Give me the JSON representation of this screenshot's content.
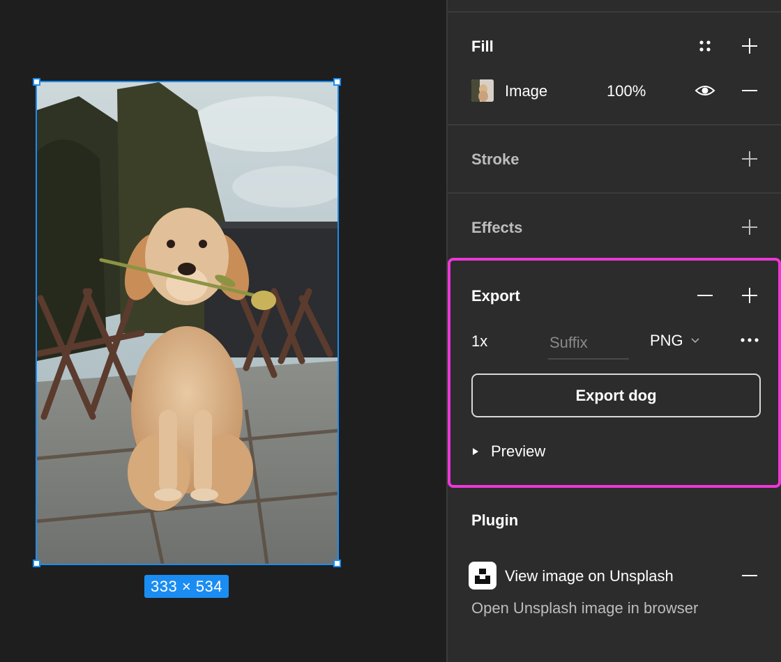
{
  "canvas": {
    "frame_size_label": "333 × 534"
  },
  "fill": {
    "title": "Fill",
    "layer": {
      "label": "Image",
      "opacity": "100%"
    }
  },
  "stroke": {
    "title": "Stroke"
  },
  "effects": {
    "title": "Effects"
  },
  "export": {
    "title": "Export",
    "scale": "1x",
    "suffix_placeholder": "Suffix",
    "format": "PNG",
    "button_label": "Export dog",
    "preview_label": "Preview"
  },
  "plugin": {
    "title": "Plugin",
    "name": "View image on Unsplash",
    "description": "Open Unsplash image in browser"
  },
  "colors": {
    "canvas_bg": "#1e1e1e",
    "panel_bg": "#2c2c2c",
    "selection": "#1b8df2",
    "highlight": "#ef36d8"
  }
}
